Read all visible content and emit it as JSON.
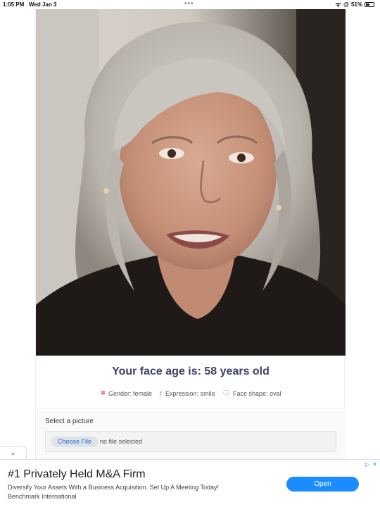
{
  "status_bar": {
    "time": "1:05 PM",
    "date": "Wed Jan 3",
    "battery": "51%",
    "battery_level": 0.51,
    "wifi_icon": "wifi-icon",
    "at_icon": "at-icon"
  },
  "result": {
    "title": "Your face age is: 58 years old",
    "title_color": "#3b4366",
    "gender": "Gender: female",
    "expression": "Expression: smile",
    "face_shape": "Face shape: oval"
  },
  "upload": {
    "label": "Select a picture",
    "button": "Choose File",
    "status": "no file selected"
  },
  "ad": {
    "title": "#1 Privately Held M&A Firm",
    "description": "Diversify Your Assets With a Business Acquisition. Set Up A Meeting Today!",
    "brand": "Benchmark International",
    "cta": "Open",
    "cta_color": "#1a8cff"
  }
}
